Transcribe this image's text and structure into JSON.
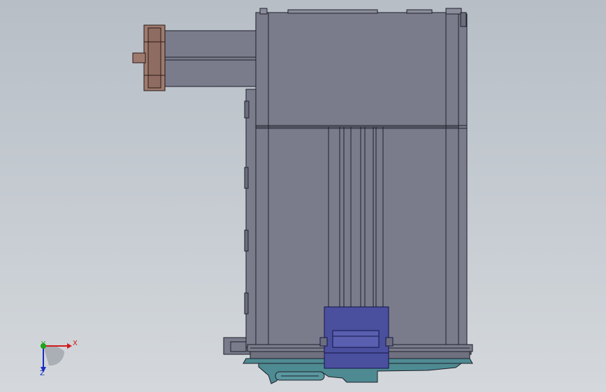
{
  "viewport": {
    "background_top": "#b7bec6",
    "background_bottom": "#d4d8dc"
  },
  "model": {
    "body_color": "#7a7c8c",
    "outline_color": "#1e1f28",
    "flange_color": "#9e7a6e",
    "base_color": "#4e8a92",
    "connector_color": "#4a4f9e"
  },
  "triad": {
    "x_label": "X",
    "y_label": "Y",
    "z_label": "Z",
    "x_color": "#d11a1a",
    "y_color": "#1aa51a",
    "z_color": "#1a2cc4"
  }
}
